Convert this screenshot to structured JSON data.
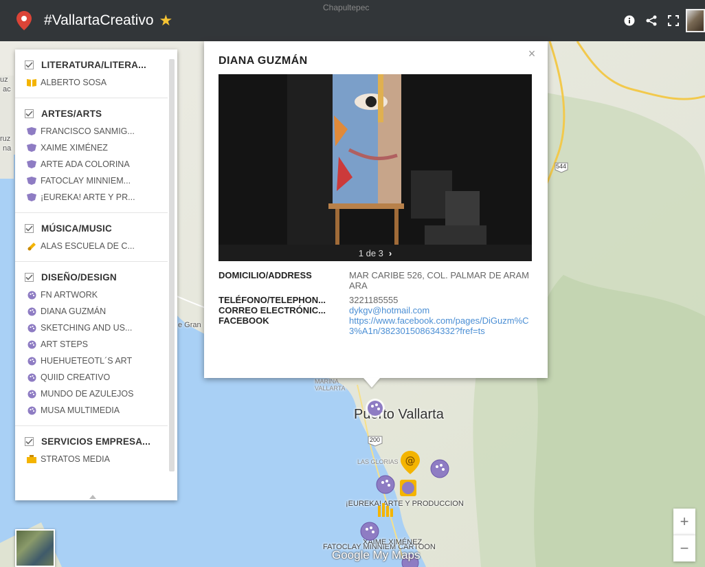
{
  "header": {
    "title": "#VallartaCreativo",
    "top_label": "Chapultepec",
    "icons": [
      "map-pin-logo",
      "star-icon",
      "info-icon",
      "share-icon",
      "fullscreen-icon",
      "avatar"
    ]
  },
  "legend": {
    "layers": [
      {
        "title": "LITERATURA/LITERA...",
        "items": [
          "ALBERTO SOSA"
        ]
      },
      {
        "title": "ARTES/ARTS",
        "items": [
          "FRANCISCO SANMIG...",
          "XAIME XIMÉNEZ",
          "ARTE ADA COLORINA",
          "FATOCLAY MINNIEM...",
          "¡EUREKA! ARTE Y PR..."
        ]
      },
      {
        "title": "MÚSICA/MUSIC",
        "items": [
          "ALAS ESCUELA DE C..."
        ]
      },
      {
        "title": "DISEÑO/DESIGN",
        "items": [
          "FN ARTWORK",
          "DIANA GUZMÁN",
          "SKETCHING AND US...",
          "ART STEPS",
          "HUEHUETEOTL´S ART",
          "QUIID CREATIVO",
          "MUNDO DE AZULEJOS",
          "MUSA MULTIMEDIA"
        ]
      },
      {
        "title": "SERVICIOS EMPRESA...",
        "items": [
          "STRATOS MEDIA"
        ]
      }
    ]
  },
  "card": {
    "title": "DIANA GUZMÁN",
    "close": "×",
    "photo_counter": "1 de 3",
    "details": {
      "address_label": "DOMICILIO/ADDRESS",
      "address_value": "MAR CARIBE 526, COL. PALMAR DE ARAMARA",
      "phone_label": "TELÉFONO/TELEPHON...",
      "phone_value": "3221185555",
      "email_label": "CORREO ELECTRÓNIC...",
      "email_value": "dykgv@hotmail.com",
      "facebook_label": "FACEBOOK",
      "facebook_value": "https://www.facebook.com/pages/DiGuzm%C3%A1n/382301508634332?fref=ts"
    }
  },
  "map": {
    "city_label": "Puerto Vallarta",
    "marina_label": "MARINA VALLARTA",
    "gran_label": "e Gran",
    "glorias_label": "LAS GLORIAS",
    "eureka_label": "¡EUREKA! ARTE Y PRODUCCION",
    "fatoclay_label": "FATOCLAY MINNIEM CARTOON",
    "ximenez_label": "XAIME XIMÉNEZ",
    "road_544": "544",
    "road_200": "200",
    "edge_labels": [
      "uz",
      "ac",
      "ruz",
      "na"
    ],
    "google_mark": "Google My Maps",
    "zoom_in": "+",
    "zoom_out": "−"
  },
  "colors": {
    "header_bg": "#282828",
    "star": "#f6c433",
    "pin_red": "#db4437",
    "arts_purple": "#8e7cc3",
    "design_purple": "#8e7cc3",
    "literature_yellow": "#f4b400",
    "link_blue": "#4a8ed4",
    "water": "#a9d0f5",
    "land": "#e8e8e0"
  }
}
